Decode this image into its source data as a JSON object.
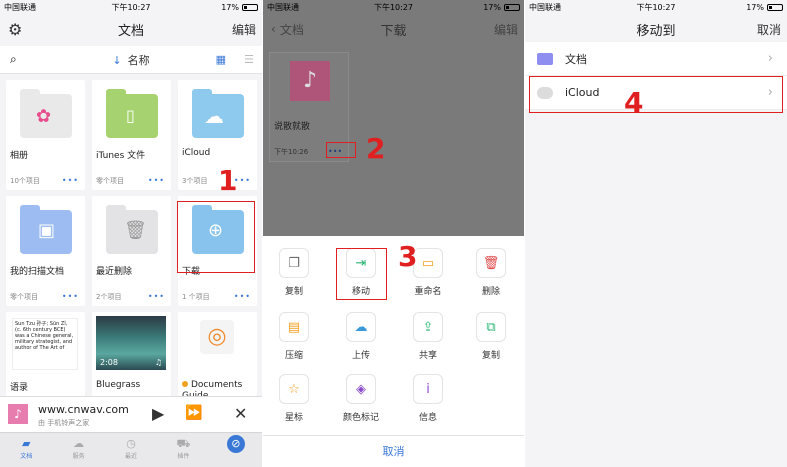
{
  "status": {
    "carrier": "中国联通",
    "time": "下午10:27",
    "battery": "17%"
  },
  "panel1": {
    "title": "文档",
    "edit": "编辑",
    "sort": "名称",
    "items": [
      {
        "name": "相册",
        "meta": "10个项目",
        "color": "#e9e9ea"
      },
      {
        "name": "iTunes 文件",
        "meta": "零个项目",
        "color": "#a6d36f"
      },
      {
        "name": "iCloud",
        "meta": "3个项目",
        "color": "#8ec9ee"
      },
      {
        "name": "我的扫描文档",
        "meta": "零个项目",
        "color": "#9cbcf2"
      },
      {
        "name": "最近删除",
        "meta": "2个项目",
        "color": "#e3e3e5"
      },
      {
        "name": "下载",
        "meta": "1 个项目",
        "color": "#87c3ec"
      },
      {
        "name": "语录",
        "meta": "",
        "color": "#ffffff"
      },
      {
        "name": "Bluegrass",
        "meta": "",
        "color": "#3c7c7a"
      },
      {
        "name": "Documents Guide",
        "meta": "",
        "color": "#f4f4f4"
      }
    ],
    "quote_text": "Sun Tzu 孙子; Sūn Zǐ, (c. 6th century BCE) was a Chinese general, military strategist, and author of The Art of",
    "video_time": "2:08",
    "dots": "•••",
    "player": {
      "title": "www.cnwav.com",
      "subtitle": "由 手机铃声之家"
    },
    "tabs": [
      "文档",
      "服务",
      "最近",
      "插件",
      ""
    ]
  },
  "panel2": {
    "back": "文档",
    "title": "下载",
    "edit": "编辑",
    "file": {
      "name": "说散就散",
      "time": "下午10:26",
      "dots": "•••"
    },
    "actions": [
      {
        "label": "复制",
        "icon": "copy-icon",
        "glyph": "❐",
        "color": "#6d6d6d"
      },
      {
        "label": "移动",
        "icon": "move-icon",
        "glyph": "⇥",
        "color": "#2bb673"
      },
      {
        "label": "重命名",
        "icon": "rename-icon",
        "glyph": "▭",
        "color": "#f0a020"
      },
      {
        "label": "删除",
        "icon": "trash-icon",
        "glyph": "🗑",
        "color": "#e04848"
      },
      {
        "label": "压缩",
        "icon": "zip-icon",
        "glyph": "▤",
        "color": "#f0a020"
      },
      {
        "label": "上传",
        "icon": "upload-cloud-icon",
        "glyph": "☁",
        "color": "#3a9ad9"
      },
      {
        "label": "共享",
        "icon": "share-icon",
        "glyph": "⇪",
        "color": "#2bb673"
      },
      {
        "label": "复制",
        "icon": "duplicate-icon",
        "glyph": "⧉",
        "color": "#2bb673"
      },
      {
        "label": "星标",
        "icon": "star-icon",
        "glyph": "☆",
        "color": "#f0a020"
      },
      {
        "label": "颜色标记",
        "icon": "tag-icon",
        "glyph": "◈",
        "color": "#8a4cc9"
      },
      {
        "label": "信息",
        "icon": "info-icon",
        "glyph": "ⅰ",
        "color": "#8a4cc9"
      }
    ],
    "cancel": "取消"
  },
  "panel3": {
    "title": "移动到",
    "cancel": "取消",
    "rows": [
      {
        "label": "文档",
        "color": "#8e8ef0"
      },
      {
        "label": "iCloud",
        "color": "#dcdcdc"
      }
    ]
  },
  "steps": [
    "1",
    "2",
    "3",
    "4"
  ]
}
